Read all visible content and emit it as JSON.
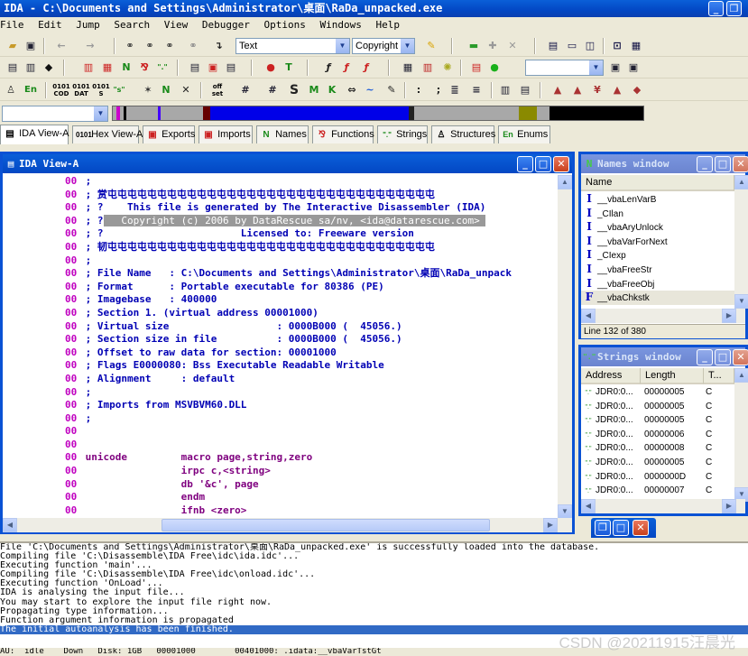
{
  "titlebar": {
    "title": "IDA - C:\\Documents and Settings\\Administrator\\桌面\\RaDa_unpacked.exe"
  },
  "menu": [
    "File",
    "Edit",
    "Jump",
    "Search",
    "View",
    "Debugger",
    "Options",
    "Windows",
    "Help"
  ],
  "toolbar": {
    "text_combo": "Text",
    "copyright_combo": "Copyright (c",
    "icons": {
      "names_n": "N",
      "text_t": "T",
      "ins_k": "K",
      "ins_s": "S",
      "ins_m": "M",
      "strings_s": "\"s\"",
      "en": "En"
    }
  },
  "tabs": [
    {
      "label": "IDA View-A",
      "icon": "ida-view-icon"
    },
    {
      "label": "Hex View-A",
      "icon": "hex-view-icon"
    },
    {
      "label": "Exports",
      "icon": "exports-icon"
    },
    {
      "label": "Imports",
      "icon": "imports-icon"
    },
    {
      "label": "Names",
      "icon": "names-icon"
    },
    {
      "label": "Functions",
      "icon": "functions-icon"
    },
    {
      "label": "Strings",
      "icon": "strings-icon"
    },
    {
      "label": "Structures",
      "icon": "structures-icon"
    },
    {
      "label": "Enums",
      "icon": "enums-icon"
    }
  ],
  "ida_view": {
    "title": "IDA View-A",
    "lines": [
      {
        "addr": "00",
        "text": " ;",
        "cls": "cm"
      },
      {
        "addr": "00",
        "text": " ; 赏屯屯屯屯屯屯屯屯屯屯屯屯屯屯屯屯屯屯屯屯屯屯屯屯屯屯屯屯屯屯屯屯屯",
        "cls": "cm"
      },
      {
        "addr": "00",
        "text": " ; ?    This file is generated by The Interactive Disassembler (IDA)",
        "cls": "cm"
      },
      {
        "addr": "00",
        "text": " ; ?",
        "cls": "cm",
        "hl": "   Copyright (c) 2006 by DataRescue sa/nv, <ida@datarescue.com> "
      },
      {
        "addr": "00",
        "text": " ; ?                       Licensed to: Freeware version",
        "cls": "cm"
      },
      {
        "addr": "00",
        "text": " ; 韧屯屯屯屯屯屯屯屯屯屯屯屯屯屯屯屯屯屯屯屯屯屯屯屯屯屯屯屯屯屯屯屯屯",
        "cls": "cm"
      },
      {
        "addr": "00",
        "text": " ;",
        "cls": "cm"
      },
      {
        "addr": "00",
        "text": " ; File Name   : C:\\Documents and Settings\\Administrator\\桌面\\RaDa_unpack",
        "cls": "cm"
      },
      {
        "addr": "00",
        "text": " ; Format      : Portable executable for 80386 (PE)",
        "cls": "cm"
      },
      {
        "addr": "00",
        "text": " ; Imagebase   : 400000",
        "cls": "cm"
      },
      {
        "addr": "00",
        "text": " ; Section 1. (virtual address 00001000)",
        "cls": "cm"
      },
      {
        "addr": "00",
        "text": " ; Virtual size                  : 0000B000 (  45056.)",
        "cls": "cm"
      },
      {
        "addr": "00",
        "text": " ; Section size in file          : 0000B000 (  45056.)",
        "cls": "cm"
      },
      {
        "addr": "00",
        "text": " ; Offset to raw data for section: 00001000",
        "cls": "cm"
      },
      {
        "addr": "00",
        "text": " ; Flags E0000080: Bss Executable Readable Writable",
        "cls": "cm"
      },
      {
        "addr": "00",
        "text": " ; Alignment     : default",
        "cls": "cm"
      },
      {
        "addr": "00",
        "text": " ;",
        "cls": "cm"
      },
      {
        "addr": "00",
        "text": " ; Imports from MSVBVM60.DLL",
        "cls": "cm"
      },
      {
        "addr": "00",
        "text": " ;",
        "cls": "cm"
      },
      {
        "addr": "00",
        "text": "",
        "cls": "cm"
      },
      {
        "addr": "00",
        "text": "",
        "cls": "cm"
      },
      {
        "addr": "00",
        "text": " unicode         macro page,string,zero",
        "cls": "di"
      },
      {
        "addr": "00",
        "text": "                 irpc c,<string>",
        "cls": "di"
      },
      {
        "addr": "00",
        "text": "                 db '&c', page",
        "cls": "di"
      },
      {
        "addr": "00",
        "text": "                 endm",
        "cls": "di"
      },
      {
        "addr": "00",
        "text": "                 ifnb <zero>",
        "cls": "di"
      }
    ]
  },
  "names_window": {
    "title": "Names window",
    "header": "Name",
    "items": [
      {
        "kind": "I",
        "name": "__vbaLenVarB"
      },
      {
        "kind": "I",
        "name": "_CIlan"
      },
      {
        "kind": "I",
        "name": "__vbaAryUnlock"
      },
      {
        "kind": "I",
        "name": "__vbaVarForNext"
      },
      {
        "kind": "I",
        "name": "_CIexp"
      },
      {
        "kind": "I",
        "name": "__vbaFreeStr"
      },
      {
        "kind": "I",
        "name": "__vbaFreeObj"
      },
      {
        "kind": "F",
        "name": "__vbaChkstk"
      }
    ],
    "status": "Line 132 of 380"
  },
  "strings_window": {
    "title": "Strings window",
    "columns": [
      "Address",
      "Length",
      "T..."
    ],
    "rows": [
      {
        "addr": "JDR0:0...",
        "len": "00000005",
        "type": "C"
      },
      {
        "addr": "JDR0:0...",
        "len": "00000005",
        "type": "C"
      },
      {
        "addr": "JDR0:0...",
        "len": "00000005",
        "type": "C"
      },
      {
        "addr": "JDR0:0...",
        "len": "00000006",
        "type": "C"
      },
      {
        "addr": "JDR0:0...",
        "len": "00000008",
        "type": "C"
      },
      {
        "addr": "JDR0:0...",
        "len": "00000005",
        "type": "C"
      },
      {
        "addr": "JDR0:0...",
        "len": "0000000D",
        "type": "C"
      },
      {
        "addr": "JDR0:0...",
        "len": "00000007",
        "type": "C"
      }
    ]
  },
  "output": {
    "lines": [
      "File 'C:\\Documents and Settings\\Administrator\\桌面\\RaDa_unpacked.exe' is successfully loaded into the database.",
      "Compiling file 'C:\\Disassemble\\IDA Free\\idc\\ida.idc'...",
      "Executing function 'main'...",
      "Compiling file 'C:\\Disassemble\\IDA Free\\idc\\onload.idc'...",
      "Executing function 'OnLoad'...",
      "IDA is analysing the input file...",
      "You may start to explore the input file right now.",
      "Propagating type information...",
      "Function argument information is propagated"
    ],
    "selected_line": "The initial autoanalysis has been finished."
  },
  "statusbar": {
    "text": "AU:  idle    Down   Disk: 1GB   00001000        00401000: .idata:__vbaVarTstGt"
  },
  "watermark": "CSDN @20211915汪晨光"
}
